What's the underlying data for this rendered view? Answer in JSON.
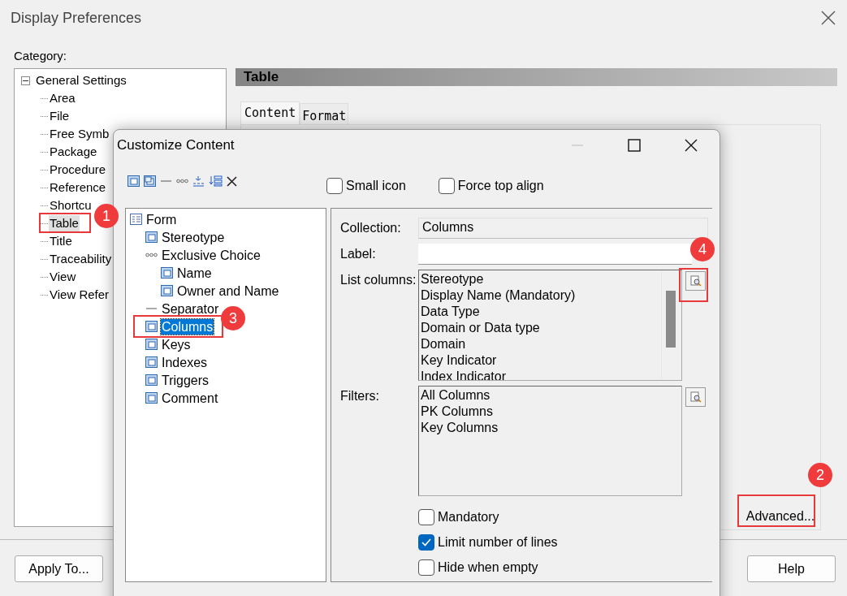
{
  "window": {
    "title": "Display Preferences"
  },
  "category": {
    "label": "Category:",
    "tree": [
      {
        "label": "General Settings",
        "expanded": true,
        "selected": false,
        "children": [
          {
            "label": "Area",
            "selected": false
          },
          {
            "label": "File",
            "selected": false
          },
          {
            "label": "Free Symb",
            "selected": false
          },
          {
            "label": "Package",
            "selected": false
          },
          {
            "label": "Procedure",
            "selected": false
          },
          {
            "label": "Reference",
            "selected": false
          },
          {
            "label": "Shortcu",
            "selected": false
          },
          {
            "label": "Table",
            "selected": true
          },
          {
            "label": "Title",
            "selected": false
          },
          {
            "label": "Traceability",
            "selected": false
          },
          {
            "label": "View",
            "selected": false
          },
          {
            "label": "View Refer",
            "selected": false
          }
        ]
      }
    ]
  },
  "section": {
    "title": "Table",
    "tabs": [
      {
        "label": "Content",
        "selected": true
      },
      {
        "label": "Format",
        "selected": false
      }
    ],
    "advanced_button": "Advanced..."
  },
  "buttons": {
    "apply": "Apply To...",
    "help": "Help"
  },
  "dialog": {
    "title": "Customize Content",
    "toolbar": [
      {
        "kind": "attribute"
      },
      {
        "kind": "attributes"
      },
      {
        "kind": "separator"
      },
      {
        "kind": "choice"
      },
      {
        "kind": "group"
      },
      {
        "kind": "insert"
      },
      {
        "kind": "delete"
      }
    ],
    "options": [
      {
        "label": "Small icon",
        "checked": false
      },
      {
        "label": "Force top align",
        "checked": false
      }
    ],
    "tree": [
      {
        "label": "Form",
        "kind": "form",
        "selected": false,
        "children": [
          {
            "label": "Stereotype",
            "kind": "attribute",
            "selected": false
          },
          {
            "label": "Exclusive Choice",
            "kind": "choice",
            "selected": false,
            "children": [
              {
                "label": "Name",
                "kind": "attribute",
                "selected": false
              },
              {
                "label": "Owner and Name",
                "kind": "attribute",
                "selected": false
              }
            ]
          },
          {
            "label": "Separator",
            "kind": "separator",
            "selected": false
          },
          {
            "label": "Columns",
            "kind": "attribute",
            "selected": true
          },
          {
            "label": "Keys",
            "kind": "attribute",
            "selected": false
          },
          {
            "label": "Indexes",
            "kind": "attribute",
            "selected": false
          },
          {
            "label": "Triggers",
            "kind": "attribute",
            "selected": false
          },
          {
            "label": "Comment",
            "kind": "attribute",
            "selected": false
          }
        ]
      }
    ],
    "collection": {
      "label": "Collection:",
      "value": "Columns"
    },
    "label_field": {
      "label": "Label:"
    },
    "list_columns": {
      "label": "List columns:",
      "items": [
        "Stereotype",
        "Display Name (Mandatory)",
        "Data Type",
        "Domain or Data type",
        "Domain",
        "Key Indicator",
        "Index Indicator"
      ]
    },
    "filters": {
      "label": "Filters:",
      "items": [
        "All Columns",
        "PK Columns",
        "Key Columns"
      ]
    },
    "flags": [
      {
        "label": "Mandatory",
        "checked": false
      },
      {
        "label": "Limit number of lines",
        "checked": true
      },
      {
        "label": "Hide when empty",
        "checked": false
      }
    ]
  },
  "annotations": [
    {
      "label": "1"
    },
    {
      "label": "2"
    },
    {
      "label": "3"
    },
    {
      "label": "4"
    }
  ]
}
